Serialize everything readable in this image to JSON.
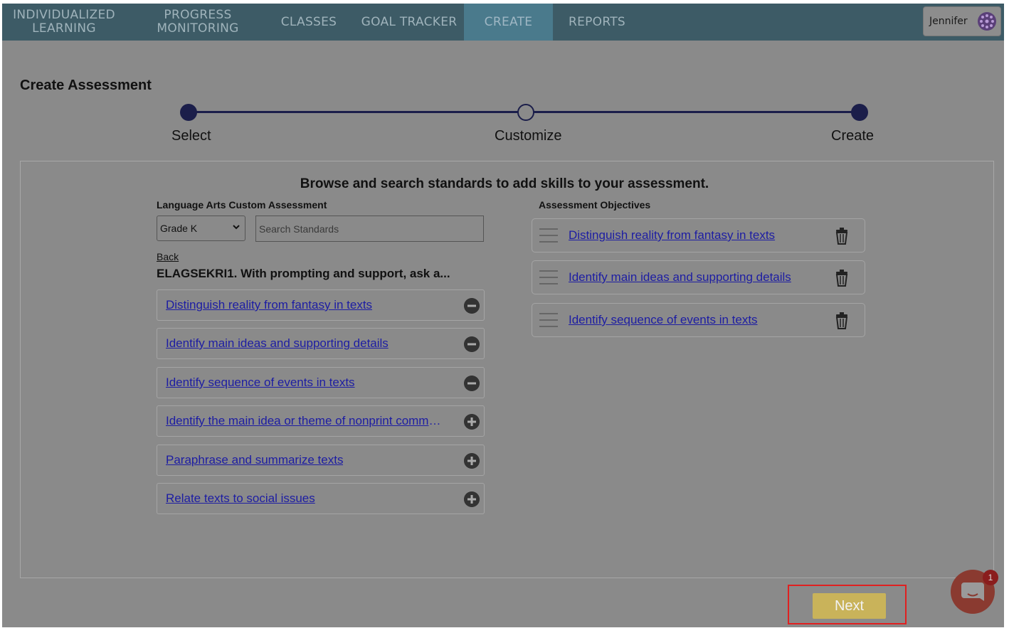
{
  "nav": {
    "items": [
      {
        "line1": "INDIVIDUALIZED",
        "line2": "LEARNING"
      },
      {
        "line1": "PROGRESS",
        "line2": "MONITORING"
      },
      {
        "label": "CLASSES"
      },
      {
        "label": "GOAL TRACKER"
      },
      {
        "label": "CREATE",
        "active": true
      },
      {
        "label": "REPORTS"
      }
    ],
    "user_name": "Jennifer"
  },
  "page_title": "Create Assessment",
  "stepper": {
    "steps": [
      {
        "label": "Select",
        "state": "complete"
      },
      {
        "label": "Customize",
        "state": "current"
      },
      {
        "label": "Create",
        "state": "complete"
      }
    ]
  },
  "panel": {
    "heading": "Browse and search standards to add skills to your assessment.",
    "left_label": "Language Arts Custom Assessment",
    "right_label": "Assessment Objectives",
    "grade_select": {
      "value": "Grade K"
    },
    "search": {
      "placeholder": "Search Standards"
    },
    "back_label": "Back",
    "standard_title": "ELAGSEKRI1. With prompting and support, ask a...",
    "skills": [
      {
        "label": "Distinguish reality from fantasy in texts",
        "action": "remove"
      },
      {
        "label": "Identify main ideas and supporting details",
        "action": "remove"
      },
      {
        "label": "Identify sequence of events in texts",
        "action": "remove"
      },
      {
        "label": "Identify the main idea or theme of nonprint commu…",
        "action": "add"
      },
      {
        "label": "Paraphrase and summarize texts",
        "action": "add"
      },
      {
        "label": "Relate texts to social issues",
        "action": "add"
      }
    ],
    "objectives": [
      {
        "label": "Distinguish reality from fantasy in texts"
      },
      {
        "label": "Identify main ideas and supporting details"
      },
      {
        "label": "Identify sequence of events in texts"
      }
    ]
  },
  "next_label": "Next",
  "chat_badge_count": "1",
  "colors": {
    "nav_bg": "#3d5b66",
    "link": "#1d1da3",
    "stepper": "#1b1e4a",
    "next_bg": "#c9b35a",
    "highlight": "#e02020"
  }
}
